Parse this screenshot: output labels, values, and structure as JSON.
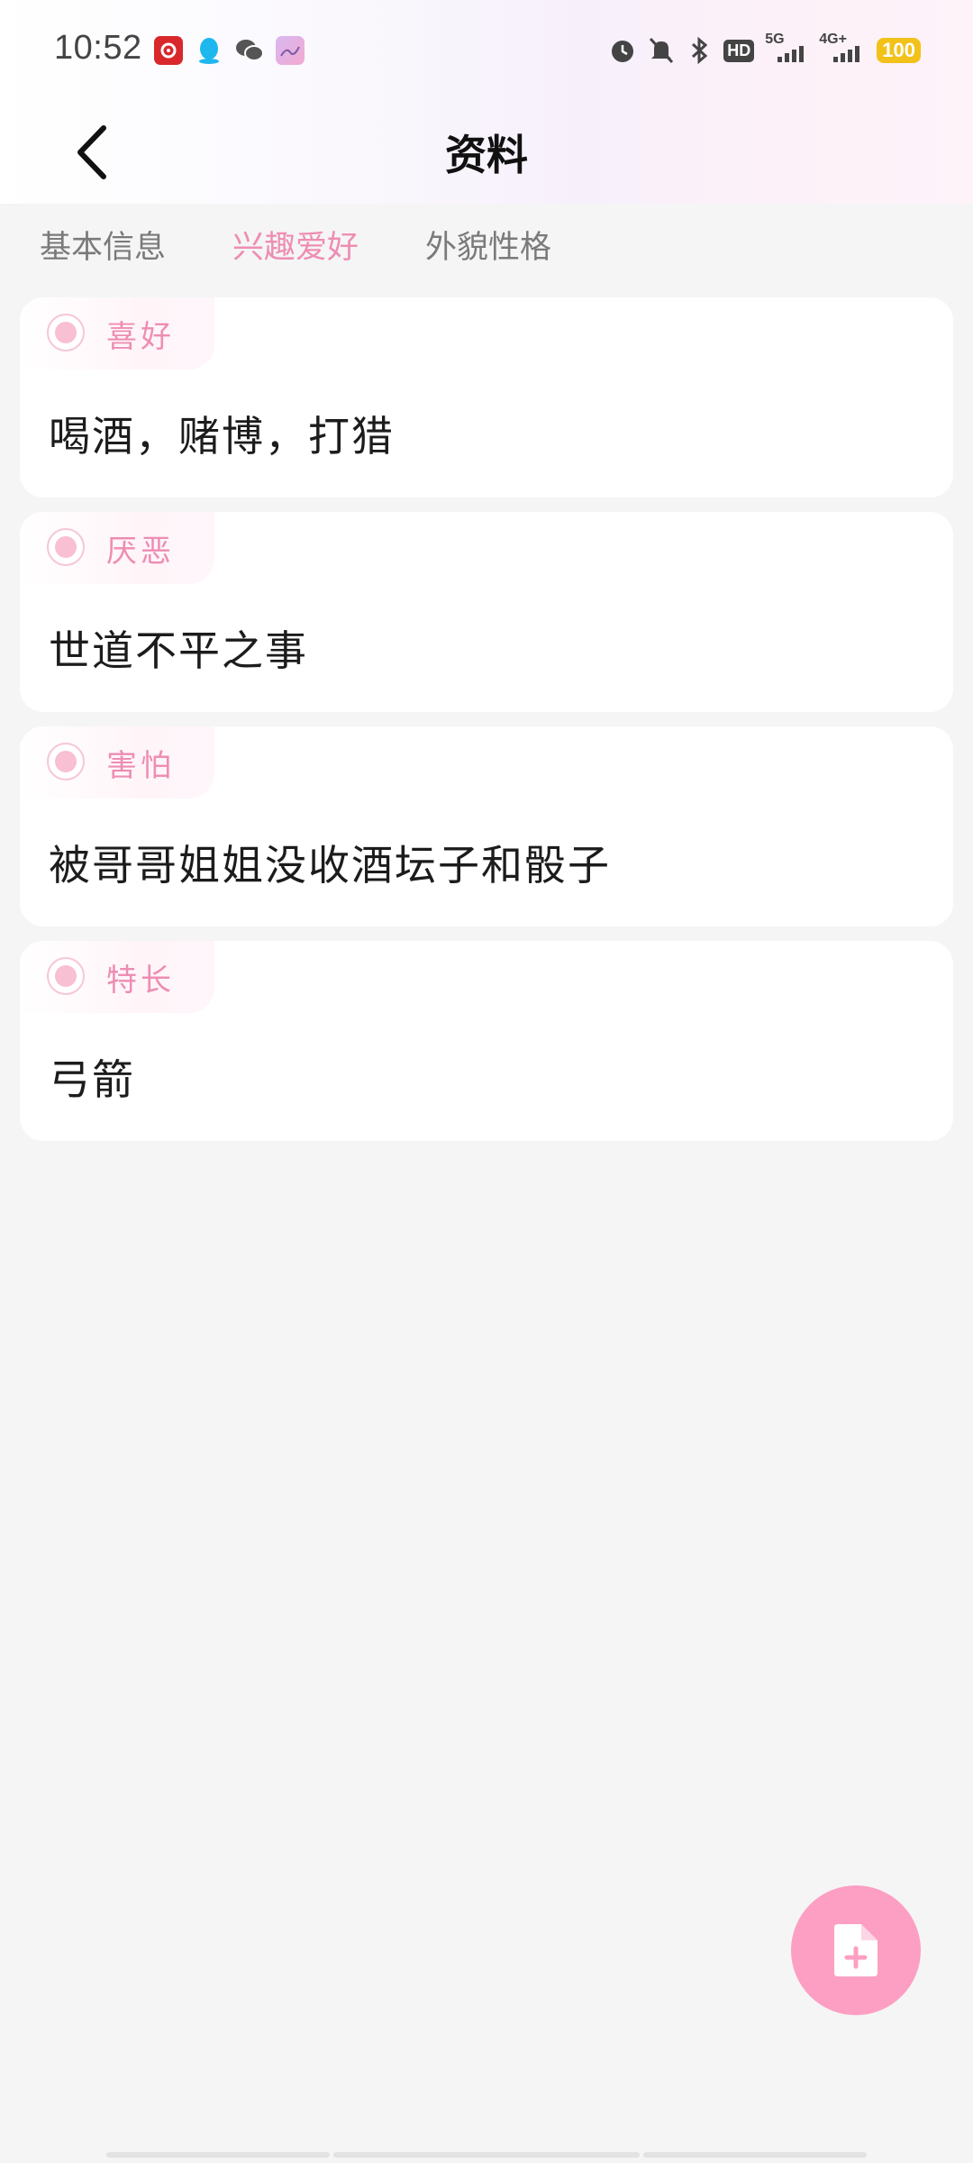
{
  "status_bar": {
    "time": "10:52",
    "battery": "100",
    "icons": [
      "netease-music-icon",
      "qq-icon",
      "wechat-icon",
      "gallery-app-icon",
      "alarm-icon",
      "mute-icon",
      "bluetooth-icon",
      "hd-icon",
      "5g-signal-icon",
      "4g-signal-icon",
      "battery-icon"
    ],
    "hd_label": "HD",
    "net_5g": "5G",
    "net_4g": "4G+"
  },
  "header": {
    "title": "资料"
  },
  "tabs": [
    {
      "label": "基本信息",
      "active": false
    },
    {
      "label": "兴趣爱好",
      "active": true
    },
    {
      "label": "外貌性格",
      "active": false
    }
  ],
  "cards": [
    {
      "label": "喜好",
      "value": "喝酒，赌博，打猎"
    },
    {
      "label": "厌恶",
      "value": "世道不平之事"
    },
    {
      "label": "害怕",
      "value": "被哥哥姐姐没收酒坛子和骰子"
    },
    {
      "label": "特长",
      "value": "弓箭"
    }
  ],
  "fab": {
    "icon": "add-file-icon"
  },
  "colors": {
    "accent": "#ee8db3",
    "fab": "#fc9fc2",
    "background": "#f5f5f5"
  }
}
